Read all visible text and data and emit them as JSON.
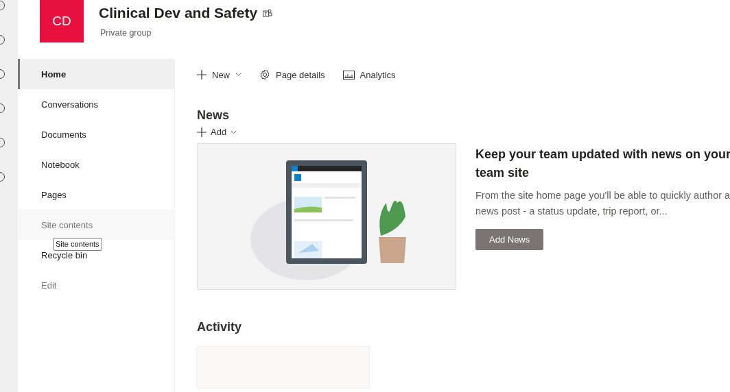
{
  "site": {
    "logo": "CD",
    "title": "Clinical Dev and Safety",
    "subtitle": "Private group"
  },
  "nav": {
    "items": [
      {
        "label": "Home",
        "selected": true,
        "hovered": false
      },
      {
        "label": "Conversations",
        "selected": false,
        "hovered": false
      },
      {
        "label": "Documents",
        "selected": false,
        "hovered": false
      },
      {
        "label": "Notebook",
        "selected": false,
        "hovered": false
      },
      {
        "label": "Pages",
        "selected": false,
        "hovered": false
      },
      {
        "label": "Site contents",
        "selected": false,
        "hovered": true
      },
      {
        "label": "Recycle bin",
        "selected": false,
        "hovered": false
      }
    ],
    "edit": "Edit",
    "tooltip": "Site contents"
  },
  "toolbar": [
    {
      "kind": "new",
      "label": "New"
    },
    {
      "kind": "details",
      "label": "Page details"
    },
    {
      "kind": "analytics",
      "label": "Analytics"
    }
  ],
  "news": {
    "title": "News",
    "add": "Add",
    "promo": {
      "kind": "picture",
      "heading": "Keep your team updated with news on your team site",
      "body": "From the site home page you'll be able to quickly author a news post - a status update, trip report, or...",
      "button": "Add News"
    }
  },
  "activity": {
    "title": "Activity"
  }
}
